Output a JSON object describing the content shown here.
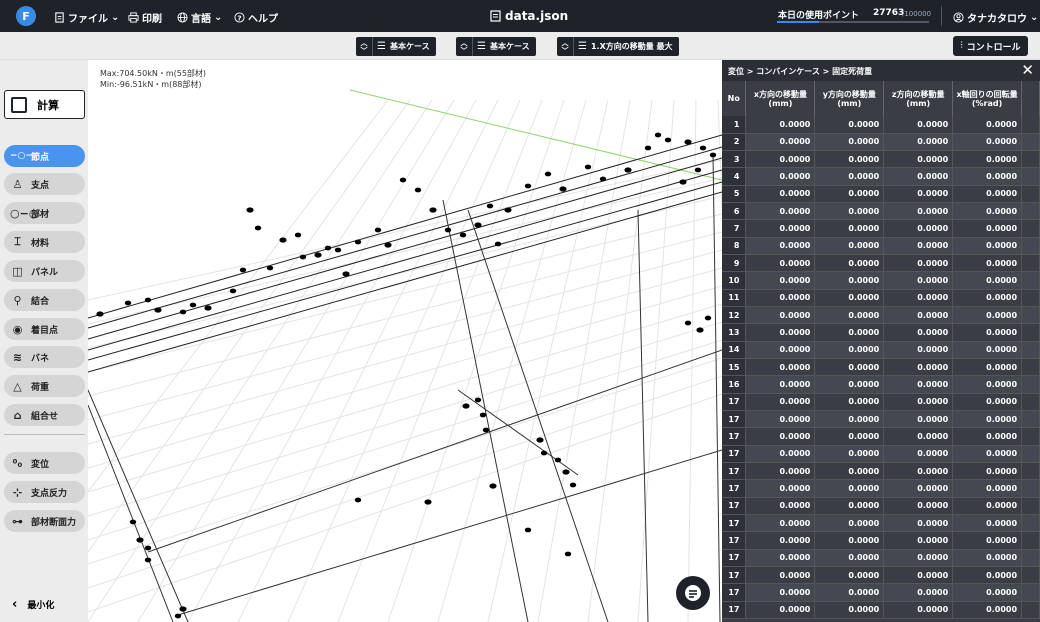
{
  "app": {
    "logo_letter": "F",
    "filename": "data.json"
  },
  "menu": {
    "file": "ファイル",
    "print": "印刷",
    "language": "言語",
    "help": "ヘルプ"
  },
  "points": {
    "label": "本日の使用ポイント",
    "value": "27763",
    "max": "/100000",
    "usage_fraction": 0.278
  },
  "user": {
    "name": "タナカタロウ"
  },
  "toolbar": {
    "selectors": [
      "基本ケース",
      "基本ケース",
      "1.X方向の移動量 最大"
    ],
    "control_label": "コントロール"
  },
  "sidebar": {
    "calc_label": "計算",
    "items": [
      {
        "label": "節点",
        "icon": "node-icon",
        "active": true
      },
      {
        "label": "支点",
        "icon": "support-icon"
      },
      {
        "label": "部材",
        "icon": "member-icon"
      },
      {
        "label": "材料",
        "icon": "material-icon"
      },
      {
        "label": "パネル",
        "icon": "panel-icon"
      },
      {
        "label": "結合",
        "icon": "joint-icon"
      },
      {
        "label": "着目点",
        "icon": "eye-icon"
      },
      {
        "label": "バネ",
        "icon": "spring-icon"
      },
      {
        "label": "荷重",
        "icon": "load-icon"
      },
      {
        "label": "組合せ",
        "icon": "combine-icon"
      },
      {
        "label": "変位",
        "icon": "displacement-icon"
      },
      {
        "label": "支点反力",
        "icon": "reaction-icon"
      },
      {
        "label": "部材断面力",
        "icon": "section-force-icon"
      }
    ],
    "minimize_label": "最小化"
  },
  "viewport": {
    "max_text": "Max:704.50kN・m(55部材)",
    "min_text": "Min:-96.51kN・m(88部材)"
  },
  "panel": {
    "breadcrumb": "変位 > コンバインケース > 固定死荷重",
    "columns": [
      "No",
      "x方向の移動量\n(mm)",
      "y方向の移動量\n(mm)",
      "z方向の移動量\n(mm)",
      "x軸回りの回転量\n(%rad)"
    ],
    "rows": [
      {
        "no": "1",
        "v": [
          "0.0000",
          "0.0000",
          "0.0000",
          "0.0000"
        ]
      },
      {
        "no": "2",
        "v": [
          "0.0000",
          "0.0000",
          "0.0000",
          "0.0000"
        ]
      },
      {
        "no": "3",
        "v": [
          "0.0000",
          "0.0000",
          "0.0000",
          "0.0000"
        ]
      },
      {
        "no": "4",
        "v": [
          "0.0000",
          "0.0000",
          "0.0000",
          "0.0000"
        ]
      },
      {
        "no": "5",
        "v": [
          "0.0000",
          "0.0000",
          "0.0000",
          "0.0000"
        ]
      },
      {
        "no": "6",
        "v": [
          "0.0000",
          "0.0000",
          "0.0000",
          "0.0000"
        ]
      },
      {
        "no": "7",
        "v": [
          "0.0000",
          "0.0000",
          "0.0000",
          "0.0000"
        ]
      },
      {
        "no": "8",
        "v": [
          "0.0000",
          "0.0000",
          "0.0000",
          "0.0000"
        ]
      },
      {
        "no": "9",
        "v": [
          "0.0000",
          "0.0000",
          "0.0000",
          "0.0000"
        ]
      },
      {
        "no": "10",
        "v": [
          "0.0000",
          "0.0000",
          "0.0000",
          "0.0000"
        ]
      },
      {
        "no": "11",
        "v": [
          "0.0000",
          "0.0000",
          "0.0000",
          "0.0000"
        ]
      },
      {
        "no": "12",
        "v": [
          "0.0000",
          "0.0000",
          "0.0000",
          "0.0000"
        ]
      },
      {
        "no": "13",
        "v": [
          "0.0000",
          "0.0000",
          "0.0000",
          "0.0000"
        ]
      },
      {
        "no": "14",
        "v": [
          "0.0000",
          "0.0000",
          "0.0000",
          "0.0000"
        ]
      },
      {
        "no": "15",
        "v": [
          "0.0000",
          "0.0000",
          "0.0000",
          "0.0000"
        ]
      },
      {
        "no": "16",
        "v": [
          "0.0000",
          "0.0000",
          "0.0000",
          "0.0000"
        ]
      },
      {
        "no": "17",
        "v": [
          "0.0000",
          "0.0000",
          "0.0000",
          "0.0000"
        ]
      },
      {
        "no": "17",
        "v": [
          "0.0000",
          "0.0000",
          "0.0000",
          "0.0000"
        ]
      },
      {
        "no": "17",
        "v": [
          "0.0000",
          "0.0000",
          "0.0000",
          "0.0000"
        ]
      },
      {
        "no": "17",
        "v": [
          "0.0000",
          "0.0000",
          "0.0000",
          "0.0000"
        ]
      },
      {
        "no": "17",
        "v": [
          "0.0000",
          "0.0000",
          "0.0000",
          "0.0000"
        ]
      },
      {
        "no": "17",
        "v": [
          "0.0000",
          "0.0000",
          "0.0000",
          "0.0000"
        ]
      },
      {
        "no": "17",
        "v": [
          "0.0000",
          "0.0000",
          "0.0000",
          "0.0000"
        ]
      },
      {
        "no": "17",
        "v": [
          "0.0000",
          "0.0000",
          "0.0000",
          "0.0000"
        ]
      },
      {
        "no": "17",
        "v": [
          "0.0000",
          "0.0000",
          "0.0000",
          "0.0000"
        ]
      },
      {
        "no": "17",
        "v": [
          "0.0000",
          "0.0000",
          "0.0000",
          "0.0000"
        ]
      },
      {
        "no": "17",
        "v": [
          "0.0000",
          "0.0000",
          "0.0000",
          "0.0000"
        ]
      },
      {
        "no": "17",
        "v": [
          "0.0000",
          "0.0000",
          "0.0000",
          "0.0000"
        ]
      },
      {
        "no": "17",
        "v": [
          "0.0000",
          "0.0000",
          "0.0000",
          "0.0000"
        ]
      }
    ]
  },
  "colors": {
    "accent": "#4a94f0",
    "dark": "#1e2229",
    "panel": "#3a3d44"
  }
}
